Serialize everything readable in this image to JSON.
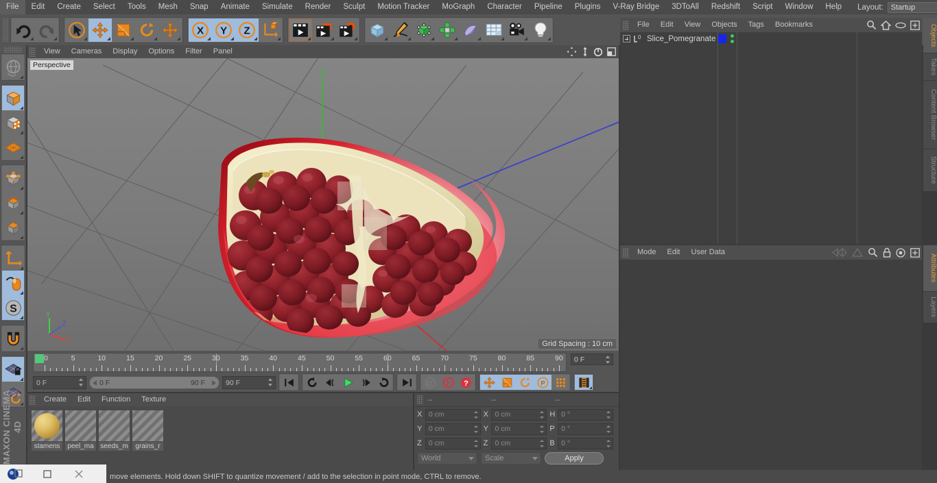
{
  "app": {
    "title": "CINEMA 4D",
    "brand": "MAXON CINEMA 4D"
  },
  "menubar": {
    "items": [
      "File",
      "Edit",
      "Create",
      "Select",
      "Tools",
      "Mesh",
      "Snap",
      "Animate",
      "Simulate",
      "Render",
      "Sculpt",
      "Motion Tracker",
      "MoGraph",
      "Character",
      "Pipeline",
      "Plugins",
      "V-Ray Bridge",
      "3DToAll",
      "Redshift",
      "Script",
      "Window",
      "Help"
    ],
    "layout_label": "Layout:",
    "layout_value": "Startup",
    "search_icon": "search-icon"
  },
  "toolbar": {
    "groups": [
      {
        "name": "history",
        "buttons": [
          {
            "icon": "undo-icon",
            "state": "normal"
          },
          {
            "icon": "redo-icon",
            "state": "disabled"
          }
        ]
      },
      {
        "name": "transform",
        "buttons": [
          {
            "icon": "select-live-icon",
            "state": "normal"
          },
          {
            "icon": "move-icon",
            "state": "selected"
          },
          {
            "icon": "scale-icon",
            "state": "normal"
          },
          {
            "icon": "rotate-icon",
            "state": "normal"
          },
          {
            "icon": "move-alt-icon",
            "state": "normal"
          }
        ]
      },
      {
        "name": "axis-locks",
        "buttons": [
          {
            "icon": "axis-x-icon",
            "state": "selected"
          },
          {
            "icon": "axis-y-icon",
            "state": "selected"
          },
          {
            "icon": "axis-z-icon",
            "state": "selected"
          },
          {
            "icon": "world-axis-icon",
            "state": "normal"
          }
        ]
      },
      {
        "name": "render",
        "buttons": [
          {
            "icon": "render-view-icon",
            "state": "active"
          },
          {
            "icon": "render-region-icon",
            "state": "normal"
          },
          {
            "icon": "render-settings-icon",
            "state": "normal"
          }
        ]
      },
      {
        "name": "create",
        "buttons": [
          {
            "icon": "cube-primitive-icon",
            "state": "normal"
          },
          {
            "icon": "spline-pen-icon",
            "state": "normal"
          },
          {
            "icon": "nurbs-icon",
            "state": "normal"
          },
          {
            "icon": "array-icon",
            "state": "normal"
          },
          {
            "icon": "deformer-icon",
            "state": "normal"
          },
          {
            "icon": "floor-scene-icon",
            "state": "normal"
          },
          {
            "icon": "camera-icon",
            "state": "normal"
          },
          {
            "icon": "light-icon",
            "state": "normal"
          }
        ]
      }
    ]
  },
  "left_toolbar": {
    "buttons": [
      {
        "icon": "globe-undo-icon",
        "state": "normal"
      },
      {
        "icon": "model-mode-icon",
        "state": "selected"
      },
      {
        "icon": "texture-mode-icon",
        "state": "normal"
      },
      {
        "icon": "polygon-mesh-icon",
        "state": "normal"
      },
      {
        "icon": "point-mode-icon",
        "state": "normal"
      },
      {
        "icon": "edge-mode-icon",
        "state": "normal"
      },
      {
        "icon": "polygon-mode-icon",
        "state": "normal"
      },
      {
        "icon": "axis-modify-icon",
        "state": "normal"
      },
      {
        "icon": "viewport-solo-mouse-icon",
        "state": "selected"
      },
      {
        "icon": "s-snap-icon",
        "state": "selected"
      },
      {
        "icon": "magnet-icon",
        "state": "normal"
      },
      {
        "icon": "workplane-lock-icon",
        "state": "selected"
      },
      {
        "icon": "workplane-rotate-icon",
        "state": "normal"
      }
    ]
  },
  "viewport": {
    "menu": [
      "View",
      "Cameras",
      "Display",
      "Options",
      "Filter",
      "Panel"
    ],
    "corner_icons": [
      "pan-icon",
      "zoom-icon",
      "rotate-view-icon",
      "maximize-view-icon"
    ],
    "label": "Perspective",
    "grid_spacing": "Grid Spacing : 10 cm",
    "axis_gizmo": {
      "x": "X",
      "y": "Y",
      "z": "Z",
      "x_color": "#e04040",
      "y_color": "#40d040",
      "z_color": "#4050e0"
    },
    "model": "Slice_Pomegranate"
  },
  "timeline": {
    "frame_start": 0,
    "frame_end": 90,
    "tick_step": 5,
    "labels": [
      "0",
      "5",
      "10",
      "15",
      "20",
      "25",
      "30",
      "35",
      "40",
      "45",
      "50",
      "55",
      "60",
      "65",
      "70",
      "75",
      "80",
      "85",
      "90"
    ],
    "current_frame_field": "0 F",
    "current_frame_left": "0 F",
    "range_start": "0 F",
    "range_end": "90 F",
    "max_frame_field": "90 F",
    "controls": [
      {
        "icon": "go-to-start-icon",
        "state": "normal"
      },
      {
        "icon": "play-reverse-loop-icon",
        "state": "normal"
      },
      {
        "icon": "step-back-icon",
        "state": "normal"
      },
      {
        "icon": "play-forward-icon",
        "state": "normal"
      },
      {
        "icon": "step-forward-icon",
        "state": "normal"
      },
      {
        "icon": "play-loop-icon",
        "state": "normal"
      },
      {
        "icon": "go-to-end-icon",
        "state": "normal"
      },
      {
        "icon": "record-key-icon",
        "state": "disabled"
      },
      {
        "icon": "autokey-icon",
        "state": "normal"
      },
      {
        "icon": "keyframe-selection-icon",
        "state": "normal"
      },
      {
        "icon": "key-position-icon",
        "state": "selected"
      },
      {
        "icon": "key-scale-icon",
        "state": "selected"
      },
      {
        "icon": "key-rotation-icon",
        "state": "selected"
      },
      {
        "icon": "key-pla-icon",
        "state": "selected"
      },
      {
        "icon": "keyframe-dots-icon",
        "state": "normal"
      },
      {
        "icon": "timeline-strip-icon",
        "state": "selected"
      }
    ]
  },
  "materials": {
    "menu": [
      "Create",
      "Edit",
      "Function",
      "Texture"
    ],
    "items": [
      {
        "name": "stamens",
        "preview": "sphere"
      },
      {
        "name": "peel_ma",
        "preview": "empty"
      },
      {
        "name": "seeds_m",
        "preview": "empty"
      },
      {
        "name": "grains_r",
        "preview": "empty"
      }
    ]
  },
  "coordinates": {
    "headers": [
      "--",
      "--",
      "--"
    ],
    "rows": [
      {
        "pos_label": "X",
        "pos_value": "0 cm",
        "size_label": "X",
        "size_value": "0 cm",
        "rot_label": "H",
        "rot_value": "0 °"
      },
      {
        "pos_label": "Y",
        "pos_value": "0 cm",
        "size_label": "Y",
        "size_value": "0 cm",
        "rot_label": "P",
        "rot_value": "0 °"
      },
      {
        "pos_label": "Z",
        "pos_value": "0 cm",
        "size_label": "Z",
        "size_value": "0 cm",
        "rot_label": "B",
        "rot_value": "0 °"
      }
    ],
    "system": "World",
    "mode": "Scale",
    "apply_label": "Apply"
  },
  "object_manager": {
    "menu": [
      "File",
      "Edit",
      "View",
      "Objects",
      "Tags",
      "Bookmarks"
    ],
    "icons": [
      "search-icon",
      "home-icon",
      "eye-icon",
      "new-layer-icon"
    ],
    "objects": [
      {
        "name": "Slice_Pomegranate",
        "icon": "polygon-object-icon",
        "tag_color": "#1626e8",
        "dots": 2
      }
    ]
  },
  "attributes": {
    "menu": [
      "Mode",
      "Edit",
      "User Data"
    ],
    "icons": [
      "history-back-icon",
      "history-forward-icon",
      "search-icon",
      "lock-icon",
      "target-icon",
      "new-tab-icon"
    ]
  },
  "right_tabs": {
    "top": [
      {
        "label": "Objects",
        "active": true
      },
      {
        "label": "Takes",
        "active": false
      },
      {
        "label": "Content Browser",
        "active": false
      },
      {
        "label": "Structure",
        "active": false
      }
    ],
    "bottom": [
      {
        "label": "Attributes",
        "active": true
      },
      {
        "label": "Layers",
        "active": false
      }
    ]
  },
  "statusbar": {
    "text": "move elements. Hold down SHIFT to quantize movement / add to the selection in point mode, CTRL to remove."
  },
  "taskbar": {
    "items": [
      "app-icon",
      "minimize-icon",
      "maximize-icon",
      "close-icon"
    ]
  },
  "colors": {
    "accent_orange": "#e0a040",
    "selection_blue": "#9fbcdd",
    "panel_bg": "#3f3f3f",
    "toolbar_bg": "#555555",
    "viewport_bg": "#7d7d7d"
  }
}
